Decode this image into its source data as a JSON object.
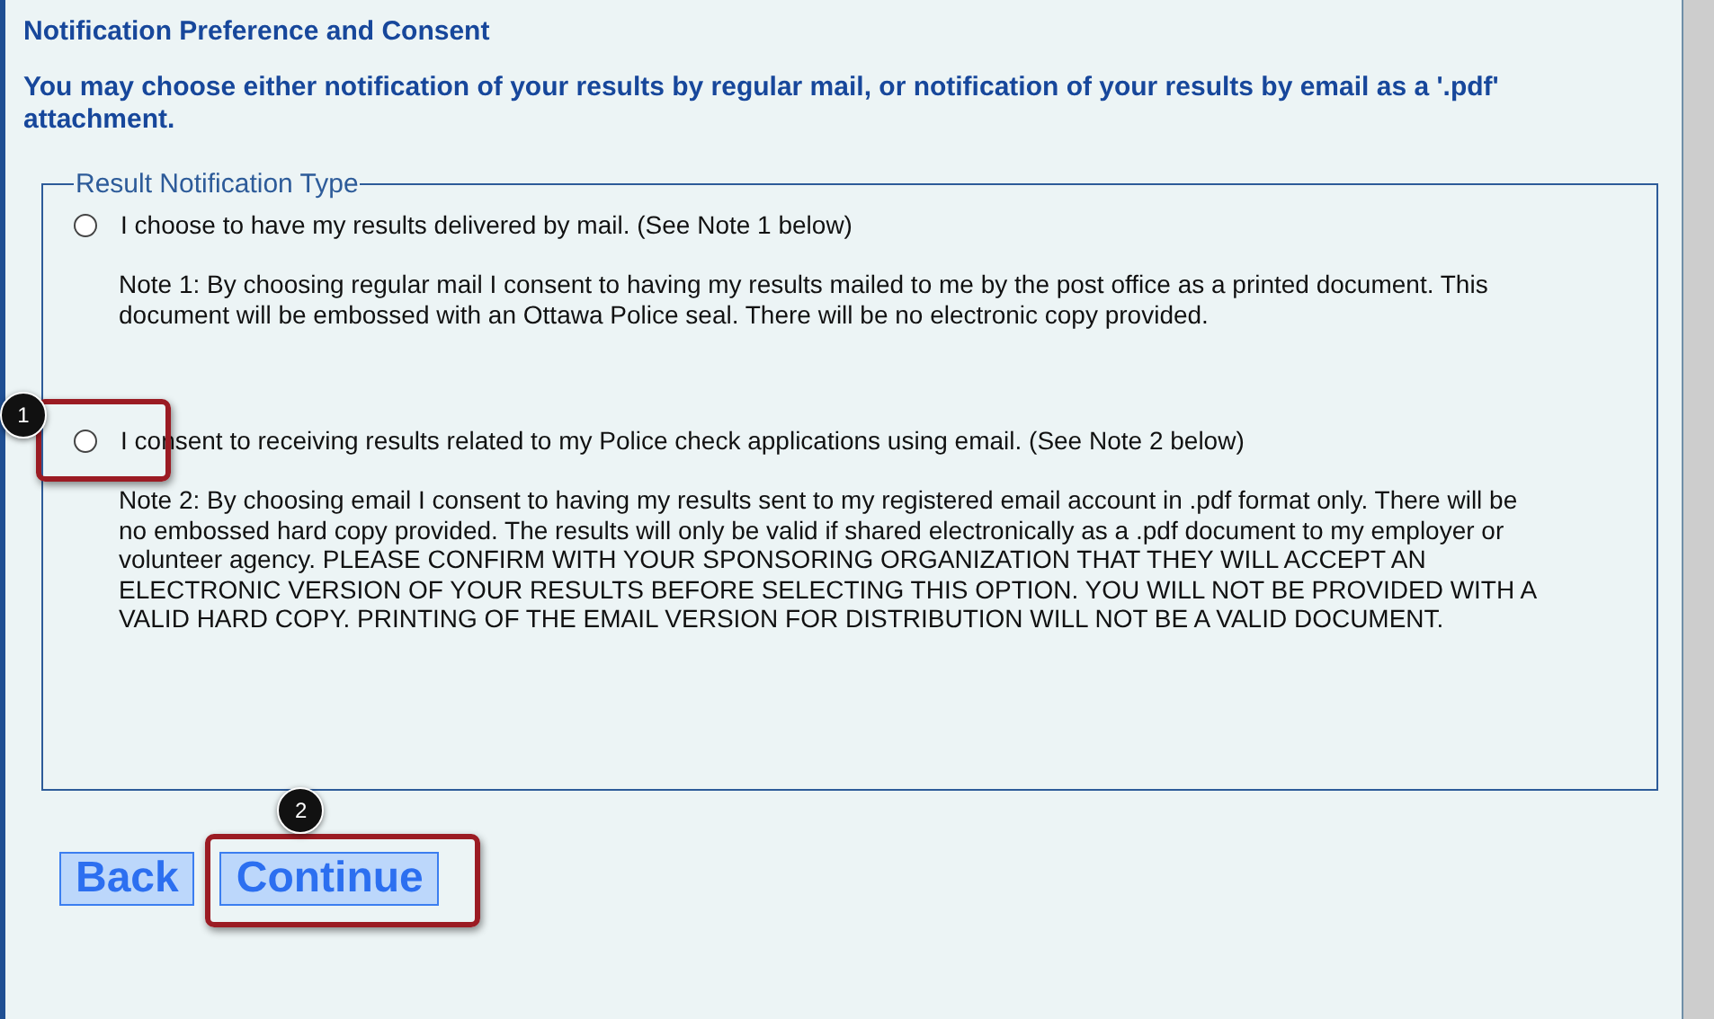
{
  "heading": "Notification Preference and Consent",
  "intro": "You may choose either notification of your results by regular mail, or notification of your results by email as a '.pdf' attachment.",
  "fieldset": {
    "legend": "Result Notification Type",
    "options": [
      {
        "label": "I choose to have my results delivered by mail. (See Note 1 below)",
        "selected": false,
        "note": "Note 1: By choosing regular mail I consent to having my results mailed to me by the post office as a printed document. This document will be embossed with an Ottawa Police seal. There will be no electronic copy provided."
      },
      {
        "label": "I consent to receiving results related to my Police check applications using email. (See Note 2 below)",
        "selected": false,
        "note": "Note 2: By choosing email I consent to having my results sent to my registered email account in .pdf format only. There will be no embossed hard copy provided. The results will only be valid if shared electronically as a .pdf document to my employer or volunteer agency. PLEASE CONFIRM WITH YOUR SPONSORING ORGANIZATION THAT THEY WILL ACCEPT AN ELECTRONIC VERSION OF YOUR RESULTS BEFORE SELECTING THIS OPTION. YOU WILL NOT BE PROVIDED WITH A VALID HARD COPY. PRINTING OF THE EMAIL VERSION FOR DISTRIBUTION WILL NOT BE A VALID DOCUMENT.",
        "callout": "1"
      }
    ]
  },
  "buttons": [
    {
      "label": "Back"
    },
    {
      "label": "Continue",
      "callout": "2"
    }
  ]
}
